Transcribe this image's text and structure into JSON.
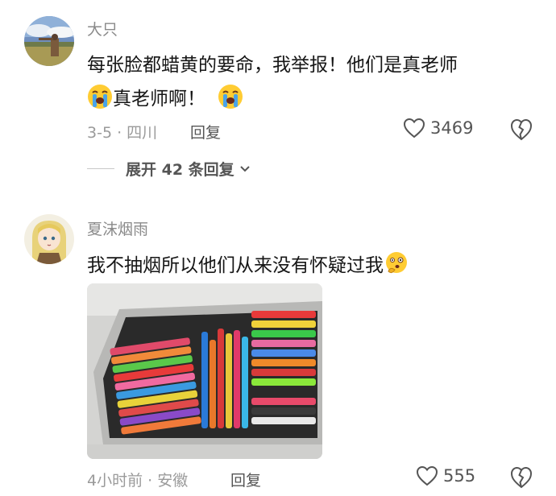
{
  "comments": [
    {
      "username": "大只",
      "text_line1": "每张脸都蜡黄的要命，我举报！他们是真老师",
      "text_line2": "真老师啊！",
      "meta": "3-5 · 四川",
      "reply_label": "回复",
      "likes": "3469",
      "expand_label": "展开 42 条回复"
    },
    {
      "username": "夏沫烟雨",
      "text": "我不抽烟所以他们从来没有怀疑过我",
      "meta": "4小时前 · 安徽",
      "reply_label": "回复",
      "likes": "555"
    }
  ],
  "icons": {
    "like": "heart-outline-icon",
    "dislike": "broken-heart-icon",
    "expand": "chevron-down-icon",
    "emoji_1": "loudly-crying-emoji",
    "emoji_2": "thinking-emoji"
  },
  "colors": {
    "username": "#8a8a8a",
    "meta": "#9a9a9a",
    "text": "#161616",
    "action": "#555555"
  }
}
